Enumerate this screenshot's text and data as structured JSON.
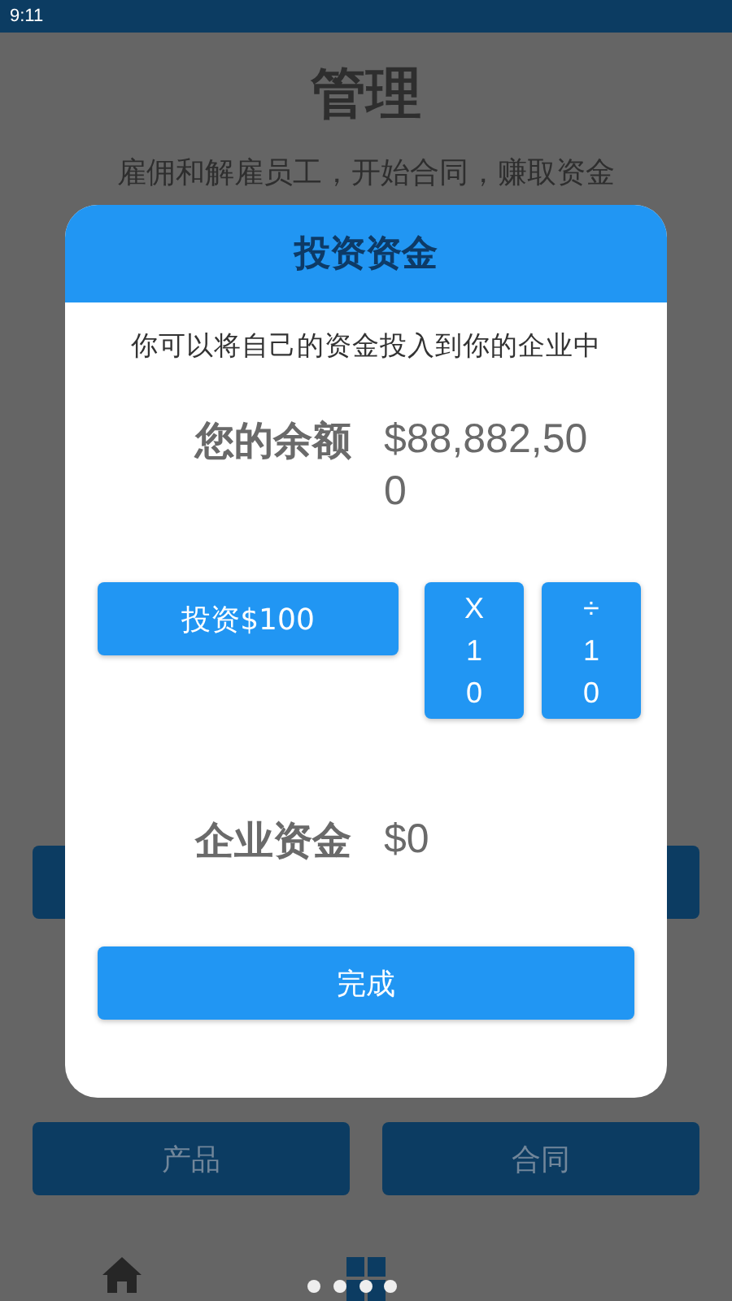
{
  "status_bar": {
    "time": "9:11"
  },
  "page": {
    "title": "管理",
    "subtitle": "雇佣和解雇员工，开始合同，赚取资金"
  },
  "menu_buttons": [
    {
      "label": "产品"
    },
    {
      "label": "合同"
    }
  ],
  "dialog": {
    "title": "投资资金",
    "description": "你可以将自己的资金投入到你的企业中",
    "balance": {
      "label": "您的余额",
      "value": "$88,882,500"
    },
    "invest_button": "投资$100",
    "multiply_button": "X10",
    "divide_button": "÷10",
    "company_funds": {
      "label": "企业资金",
      "value": "$0"
    },
    "done_button": "完成"
  }
}
